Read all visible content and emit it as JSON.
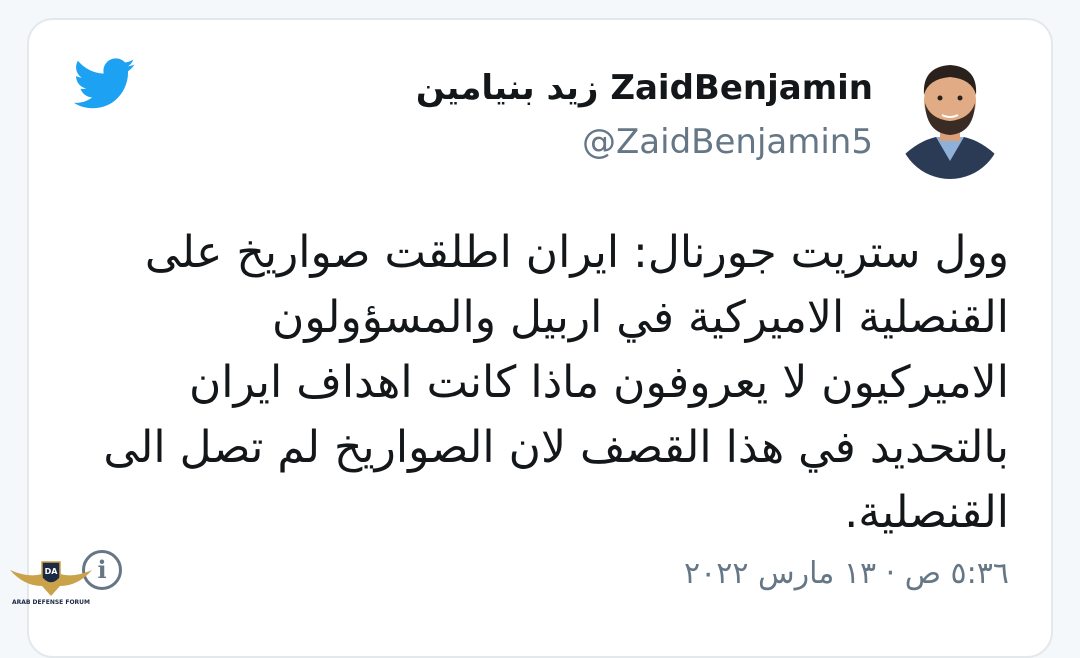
{
  "tweet": {
    "display_name": "زيد بنيامين ZaidBenjamin",
    "handle": "@ZaidBenjamin5",
    "text_lines": [
      "وول ستريت جورنال: ايران اطلقت صواريخ على",
      "القنصلية الاميركية في اربيل والمسؤولون",
      "الاميركيون لا يعروفون ماذا كانت اهداف ايران",
      "بالتحديد في هذا القصف لان الصواريخ لم تصل الى",
      "القنصلية."
    ],
    "timestamp": "٥:٣٦ ص · ١٣ مارس ٢٠٢٢"
  },
  "icons": {
    "brand": "twitter-bird-icon",
    "info": "info-icon",
    "info_glyph": "i"
  },
  "watermark": {
    "text": "ARAB DEFENSE FORUM"
  },
  "colors": {
    "twitter_blue": "#1da1f2",
    "text": "#14171a",
    "secondary": "#657786",
    "card_border": "#e3e8ec"
  }
}
